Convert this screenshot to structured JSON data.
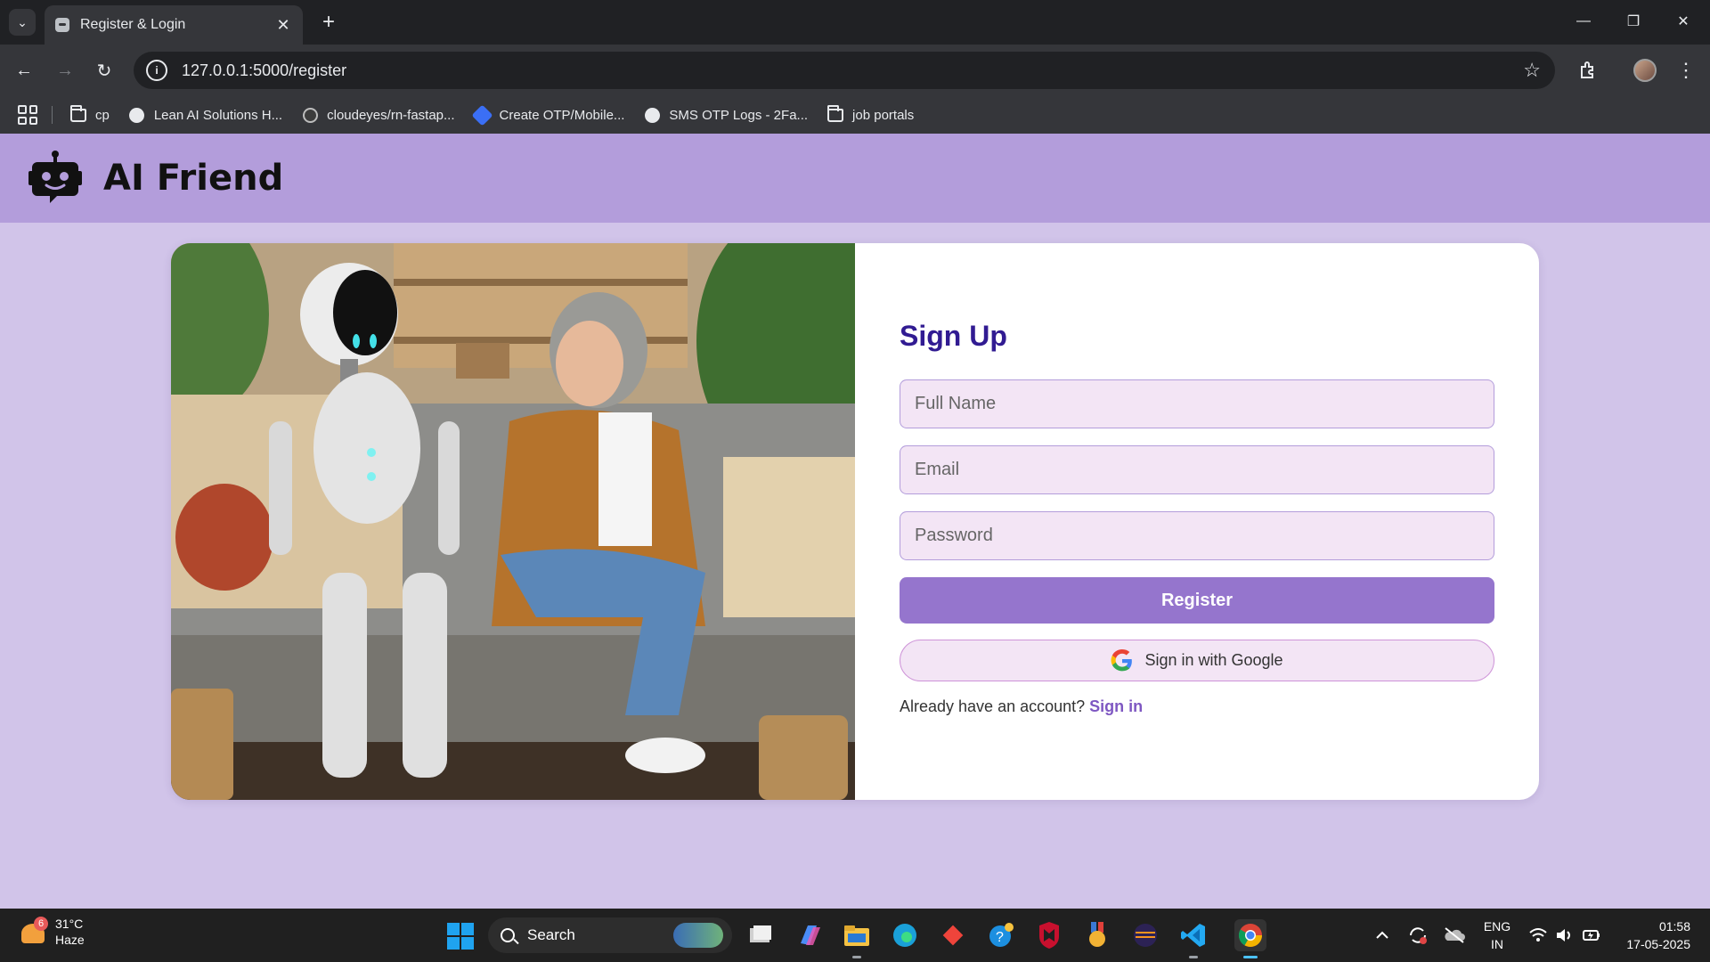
{
  "browser": {
    "tab_title": "Register & Login",
    "url": "127.0.0.1:5000/register",
    "bookmarks": [
      {
        "label": "cp",
        "icon": "folder-icon"
      },
      {
        "label": "Lean AI Solutions H...",
        "icon": "globe-icon"
      },
      {
        "label": "cloudeyes/rn-fastap...",
        "icon": "github-icon"
      },
      {
        "label": "Create OTP/Mobile...",
        "icon": "otp-app-icon"
      },
      {
        "label": "SMS OTP Logs - 2Fa...",
        "icon": "globe-icon"
      },
      {
        "label": "job portals",
        "icon": "folder-icon"
      }
    ]
  },
  "site": {
    "brand": "AI Friend",
    "logo_icon": "robot-icon",
    "header_color": "#b39ddb",
    "background_color": "#d1c4e9"
  },
  "form": {
    "title": "Sign Up",
    "full_name": {
      "placeholder": "Full Name",
      "value": ""
    },
    "email": {
      "placeholder": "Email",
      "value": ""
    },
    "password": {
      "placeholder": "Password",
      "value": ""
    },
    "register_label": "Register",
    "google_label": "Sign in with Google",
    "already_text": "Already have an account?",
    "signin_link": "Sign in",
    "accent_color": "#9575cd",
    "title_color": "#311b92"
  },
  "taskbar": {
    "weather": {
      "badge": "6",
      "temp": "31°C",
      "condition": "Haze"
    },
    "search_label": "Search",
    "language": {
      "line1": "ENG",
      "line2": "IN"
    },
    "clock": {
      "time": "01:58",
      "date": "17-05-2025"
    }
  }
}
